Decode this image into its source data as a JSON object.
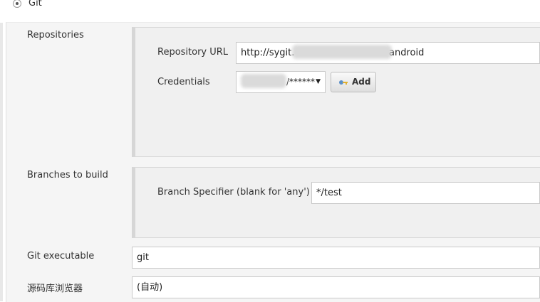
{
  "scm": {
    "option_label": "Git"
  },
  "repositories": {
    "label": "Repositories",
    "url_label": "Repository URL",
    "url_prefix": "http://sygit.",
    "url_suffix": "android",
    "credentials_label": "Credentials",
    "credentials_value": "/******",
    "add_button_label": "Add"
  },
  "branches": {
    "label": "Branches to build",
    "specifier_label": "Branch Specifier (blank for 'any')",
    "specifier_value": "*/test"
  },
  "git_executable": {
    "label": "Git executable",
    "value": "git"
  },
  "repo_browser": {
    "label": "源码库浏览器",
    "value": "(自动)"
  },
  "icons": {
    "radio": "radio-selected-icon",
    "key": "key-icon",
    "dropdown": "dropdown-arrow-icon"
  }
}
